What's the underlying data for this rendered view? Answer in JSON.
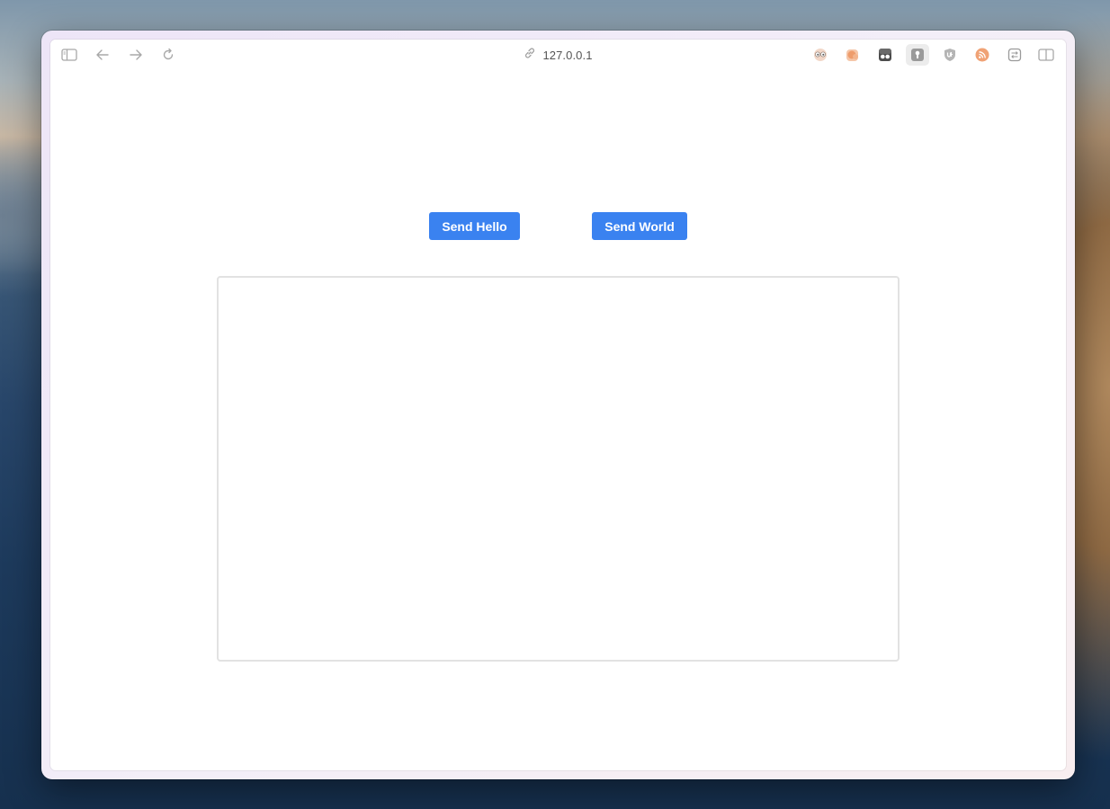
{
  "browser": {
    "address": "127.0.0.1",
    "toolbar_icons": {
      "sidebar": "sidebar-icon",
      "back": "back-arrow-icon",
      "forward": "forward-arrow-icon",
      "reload": "reload-icon",
      "link": "link-icon",
      "split_view": "split-view-icon"
    },
    "extensions": [
      {
        "icon": "eyes-extension-icon",
        "color": "#e7a27f"
      },
      {
        "icon": "orange-blob-extension-icon",
        "color": "#ee9c6b"
      },
      {
        "icon": "dark-mask-extension-icon",
        "color": "#4d4d4d"
      },
      {
        "icon": "keyhole-extension-icon",
        "color": "#9a9a9a"
      },
      {
        "icon": "shield-extension-icon",
        "color": "#a0a0a0"
      },
      {
        "icon": "rss-extension-icon",
        "color": "#f0a275"
      },
      {
        "icon": "toggle-extension-icon",
        "color": "#9a9a9a"
      }
    ]
  },
  "page": {
    "send_hello_label": "Send Hello",
    "send_world_label": "Send World",
    "output_text": ""
  },
  "colors": {
    "button_background": "#3a82f0",
    "button_text": "#ffffff",
    "box_border": "#e2e2e2"
  }
}
